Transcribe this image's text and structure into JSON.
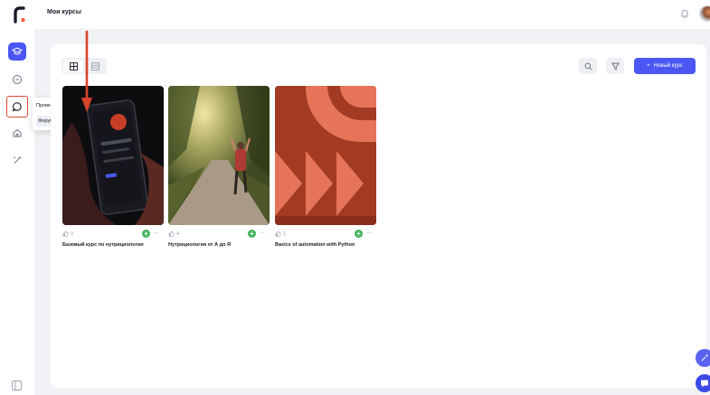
{
  "header": {
    "page_title": "Мои курсы"
  },
  "sidebar": {
    "flyout": {
      "items": [
        "Проверка",
        "Форум"
      ]
    }
  },
  "toolbar": {
    "new_course_label": "Новый курс",
    "new_course_plus": "+"
  },
  "courses": [
    {
      "title": "Базовый курс по нутрициологии",
      "likes": "0"
    },
    {
      "title": "Нутрициология от А до Я",
      "likes": "4"
    },
    {
      "title": "Basics of automation with Python",
      "likes": "2"
    }
  ],
  "card_actions": {
    "add": "+",
    "more": "—"
  },
  "colors": {
    "accent": "#4b57f5",
    "highlight": "#e0483a",
    "add_green": "#44b35a",
    "logo": "#ff5a3c"
  }
}
